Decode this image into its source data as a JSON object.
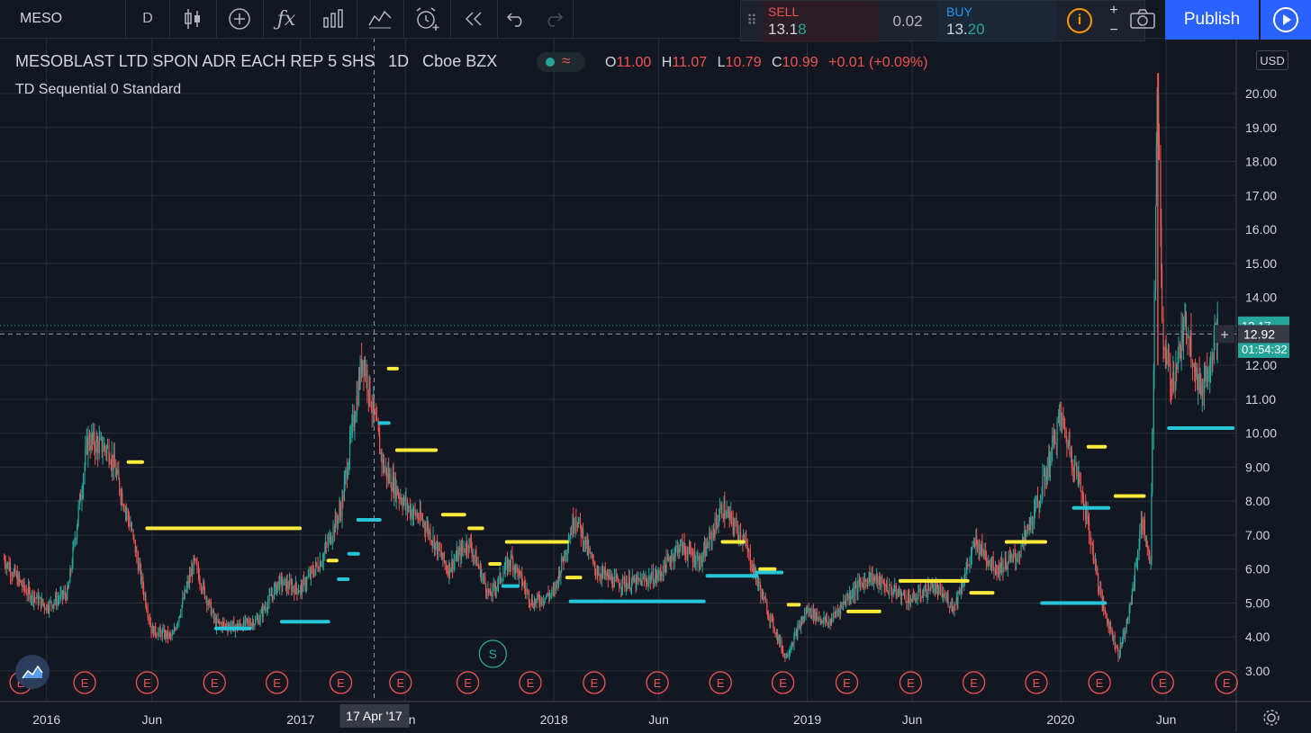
{
  "toolbar": {
    "symbol": "MESO",
    "interval": "D",
    "buttons": [
      "candles-icon",
      "add-icon",
      "fx-icon",
      "compare-bars-icon",
      "indicators-icon",
      "alert-icon",
      "replay-icon",
      "undo-icon",
      "redo-icon"
    ]
  },
  "trade": {
    "sell_label": "SELL",
    "sell_price_main": "13.1",
    "sell_price_tail": "8",
    "spread": "0.02",
    "buy_label": "BUY",
    "buy_price_main": "13.",
    "buy_price_tail": "20",
    "info": "i",
    "plus": "+",
    "minus": "−",
    "sell_color": "#ef5350",
    "buy_color": "#2196f3"
  },
  "publish_label": "Publish",
  "legend": {
    "title": "MESOBLAST LTD SPON ADR EACH REP 5 SHS",
    "interval": "1D",
    "exchange": "Cboe BZX",
    "o_label": "O",
    "o": "11.00",
    "h_label": "H",
    "h": "11.07",
    "l_label": "L",
    "l": "10.79",
    "c_label": "C",
    "c": "10.99",
    "change": "+0.01 (+0.09%)",
    "indicator": "TD Sequential 0 Standard"
  },
  "currency": "USD",
  "crosshair": {
    "date_label": "17 Apr '17",
    "price_label": "12.92"
  },
  "price_tags": {
    "last": "13.17",
    "countdown": "01:54:32"
  },
  "colors": {
    "background": "#131722",
    "grid": "#2a2e39",
    "up": "#26a69a",
    "down": "#ef5350",
    "td_resistance": "#ffeb3b",
    "td_support": "#26c6da"
  },
  "chart_data": {
    "type": "candlestick",
    "title": "MESOBLAST LTD SPON ADR EACH REP 5 SHS",
    "interval": "1D",
    "ylim": [
      2.2,
      21.0
    ],
    "y_ticks": [
      "3.00",
      "4.00",
      "5.00",
      "6.00",
      "7.00",
      "8.00",
      "9.00",
      "10.00",
      "11.00",
      "12.00",
      "13.00",
      "14.00",
      "15.00",
      "16.00",
      "17.00",
      "18.00",
      "19.00",
      "20.00"
    ],
    "x_ticks": [
      "2016",
      "Jun",
      "2017",
      "Jun",
      "2018",
      "Jun",
      "2019",
      "Jun",
      "2020",
      "Jun"
    ],
    "x_tick_dates": [
      "2016-01-01",
      "2016-06-01",
      "2017-01-01",
      "2017-06-01",
      "2018-01-01",
      "2018-06-01",
      "2019-01-01",
      "2019-06-01",
      "2020-01-01",
      "2020-06-01"
    ],
    "x_range": [
      "2015-10-26",
      "2020-09-10"
    ],
    "grid": true,
    "series": [
      {
        "name": "MESO",
        "points": [
          [
            "2015-11-01",
            6.3
          ],
          [
            "2015-12-01",
            5.4
          ],
          [
            "2016-01-01",
            4.9
          ],
          [
            "2016-02-01",
            5.3
          ],
          [
            "2016-03-01",
            9.8
          ],
          [
            "2016-04-01",
            9.5
          ],
          [
            "2016-05-01",
            7.3
          ],
          [
            "2016-06-01",
            4.2
          ],
          [
            "2016-07-01",
            4.0
          ],
          [
            "2016-08-01",
            6.2
          ],
          [
            "2016-09-01",
            4.4
          ],
          [
            "2016-10-01",
            4.3
          ],
          [
            "2016-11-01",
            4.5
          ],
          [
            "2016-12-01",
            5.6
          ],
          [
            "2017-01-01",
            5.4
          ],
          [
            "2017-02-01",
            6.3
          ],
          [
            "2017-03-01",
            7.8
          ],
          [
            "2017-04-01",
            12.3
          ],
          [
            "2017-05-01",
            9.0
          ],
          [
            "2017-06-01",
            7.9
          ],
          [
            "2017-07-01",
            7.3
          ],
          [
            "2017-08-01",
            6.0
          ],
          [
            "2017-09-01",
            6.8
          ],
          [
            "2017-10-01",
            5.2
          ],
          [
            "2017-11-01",
            6.3
          ],
          [
            "2017-12-01",
            5.0
          ],
          [
            "2018-01-01",
            5.3
          ],
          [
            "2018-02-01",
            7.6
          ],
          [
            "2018-03-01",
            6.0
          ],
          [
            "2018-04-01",
            5.6
          ],
          [
            "2018-05-01",
            5.6
          ],
          [
            "2018-06-01",
            5.8
          ],
          [
            "2018-07-01",
            6.7
          ],
          [
            "2018-08-01",
            6.2
          ],
          [
            "2018-09-01",
            7.8
          ],
          [
            "2018-10-01",
            6.9
          ],
          [
            "2018-11-01",
            5.0
          ],
          [
            "2018-12-01",
            3.4
          ],
          [
            "2019-01-01",
            4.8
          ],
          [
            "2019-02-01",
            4.4
          ],
          [
            "2019-03-01",
            5.2
          ],
          [
            "2019-04-01",
            5.8
          ],
          [
            "2019-05-01",
            5.4
          ],
          [
            "2019-06-01",
            5.1
          ],
          [
            "2019-07-01",
            5.5
          ],
          [
            "2019-08-01",
            4.9
          ],
          [
            "2019-09-01",
            6.8
          ],
          [
            "2019-10-01",
            6.0
          ],
          [
            "2019-11-01",
            6.4
          ],
          [
            "2019-12-01",
            8.0
          ],
          [
            "2020-01-01",
            10.5
          ],
          [
            "2020-02-01",
            8.3
          ],
          [
            "2020-03-01",
            5.0
          ],
          [
            "2020-03-25",
            3.5
          ],
          [
            "2020-04-10",
            4.8
          ],
          [
            "2020-04-28",
            7.5
          ],
          [
            "2020-05-10",
            6.0
          ],
          [
            "2020-05-20",
            20.6
          ],
          [
            "2020-05-28",
            12.4
          ],
          [
            "2020-06-10",
            11.5
          ],
          [
            "2020-07-01",
            13.3
          ],
          [
            "2020-07-20",
            11.2
          ],
          [
            "2020-08-01",
            12.0
          ],
          [
            "2020-08-15",
            13.17
          ]
        ]
      }
    ],
    "resistance_levels": [
      {
        "from": "2016-04-28",
        "to": "2016-05-18",
        "value": 9.15
      },
      {
        "from": "2016-05-25",
        "to": "2016-12-31",
        "value": 7.2
      },
      {
        "from": "2017-02-10",
        "to": "2017-02-22",
        "value": 6.25
      },
      {
        "from": "2017-05-08",
        "to": "2017-05-20",
        "value": 11.9
      },
      {
        "from": "2017-05-20",
        "to": "2017-07-15",
        "value": 9.5
      },
      {
        "from": "2017-07-25",
        "to": "2017-08-25",
        "value": 7.6
      },
      {
        "from": "2017-09-01",
        "to": "2017-09-20",
        "value": 7.2
      },
      {
        "from": "2017-10-01",
        "to": "2017-10-15",
        "value": 6.15
      },
      {
        "from": "2017-10-25",
        "to": "2018-01-20",
        "value": 6.8
      },
      {
        "from": "2018-01-20",
        "to": "2018-02-08",
        "value": 5.75
      },
      {
        "from": "2018-09-01",
        "to": "2018-10-01",
        "value": 6.8
      },
      {
        "from": "2018-10-25",
        "to": "2018-11-15",
        "value": 6.0
      },
      {
        "from": "2018-12-05",
        "to": "2018-12-20",
        "value": 4.95
      },
      {
        "from": "2019-03-01",
        "to": "2019-04-15",
        "value": 4.75
      },
      {
        "from": "2019-05-15",
        "to": "2019-08-20",
        "value": 5.65
      },
      {
        "from": "2019-08-25",
        "to": "2019-09-25",
        "value": 5.3
      },
      {
        "from": "2019-10-15",
        "to": "2019-12-10",
        "value": 6.8
      },
      {
        "from": "2020-02-10",
        "to": "2020-03-05",
        "value": 9.6
      },
      {
        "from": "2020-03-20",
        "to": "2020-04-30",
        "value": 8.15
      }
    ],
    "support_levels": [
      {
        "from": "2016-09-01",
        "to": "2016-10-20",
        "value": 4.25
      },
      {
        "from": "2016-12-05",
        "to": "2017-02-10",
        "value": 4.45
      },
      {
        "from": "2017-02-25",
        "to": "2017-03-10",
        "value": 5.7
      },
      {
        "from": "2017-03-12",
        "to": "2017-03-25",
        "value": 6.45
      },
      {
        "from": "2017-03-25",
        "to": "2017-04-25",
        "value": 7.45
      },
      {
        "from": "2017-04-25",
        "to": "2017-05-08",
        "value": 10.3
      },
      {
        "from": "2017-10-20",
        "to": "2017-11-10",
        "value": 5.5
      },
      {
        "from": "2018-01-25",
        "to": "2018-03-10",
        "value": 5.05
      },
      {
        "from": "2018-03-10",
        "to": "2018-08-05",
        "value": 5.05
      },
      {
        "from": "2018-08-10",
        "to": "2018-10-20",
        "value": 5.8
      },
      {
        "from": "2018-10-20",
        "to": "2018-11-25",
        "value": 5.9
      },
      {
        "from": "2019-12-05",
        "to": "2020-03-05",
        "value": 5.0
      },
      {
        "from": "2020-01-20",
        "to": "2020-03-10",
        "value": 7.8
      },
      {
        "from": "2020-06-05",
        "to": "2020-09-05",
        "value": 10.15
      }
    ],
    "earnings_markers": [
      "2015-11-25",
      "2016-02-25",
      "2016-05-25",
      "2016-08-30",
      "2016-11-28",
      "2017-02-28",
      "2017-05-25",
      "2017-08-30",
      "2017-11-28",
      "2018-02-28",
      "2018-05-30",
      "2018-08-29",
      "2018-11-27",
      "2019-02-27",
      "2019-05-30",
      "2019-08-29",
      "2019-11-27",
      "2020-02-26",
      "2020-05-27",
      "2020-08-27"
    ],
    "earnings_label": "E",
    "split_marker": {
      "date": "2017-10-05",
      "label": "S"
    }
  }
}
